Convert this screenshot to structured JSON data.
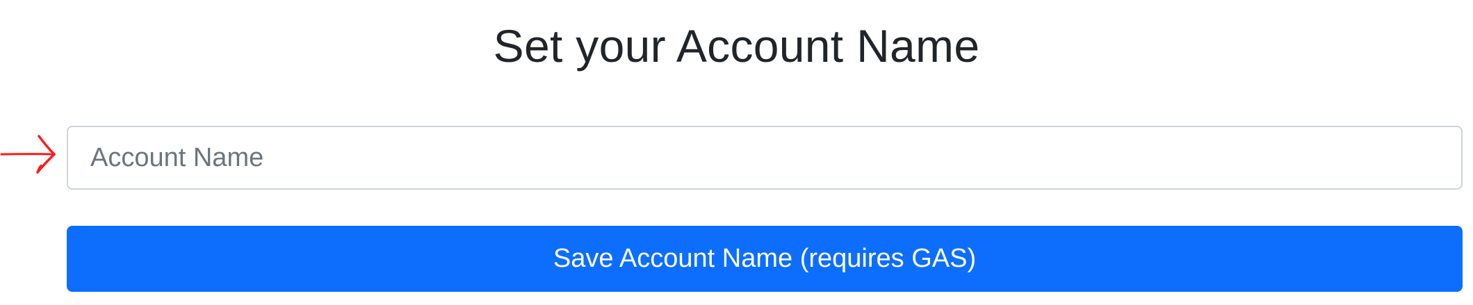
{
  "header": {
    "title": "Set your Account Name"
  },
  "form": {
    "account_name_value": "",
    "account_name_placeholder": "Account Name",
    "save_label": "Save Account Name (requires GAS)"
  },
  "colors": {
    "primary_button": "#0d6efd",
    "input_border": "#ced4da",
    "annotation_arrow": "#ff0000"
  },
  "icons": {
    "annotation": "right-arrow-icon"
  }
}
